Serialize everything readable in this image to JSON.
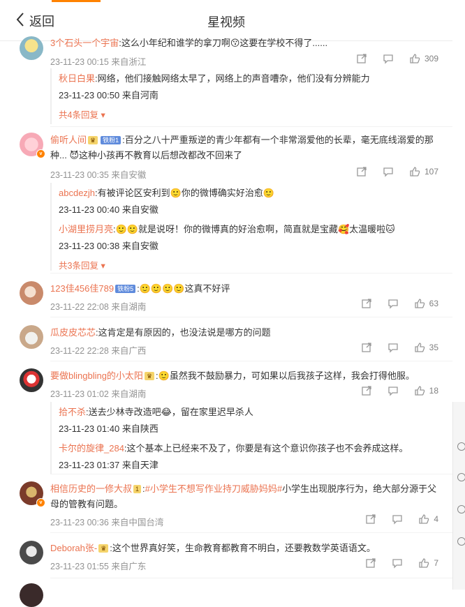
{
  "header": {
    "back_label": "返回",
    "title": "星视频"
  },
  "comments": [
    {
      "name": "3个石头一个宇宙",
      "text": ":这么小年纪和谁学的拿刀啊😗这要在学校不得了......",
      "time": "23-11-23 00:15 来自浙江",
      "likes": "309",
      "replies": [
        {
          "name": "秋日白果",
          "text": ":网络，他们接触网络太早了，网络上的声音嘈杂，他们没有分辨能力",
          "time": "23-11-23 00:50 来自河南"
        }
      ],
      "more": "共4条回复"
    },
    {
      "name": "偷听人间",
      "badge": "铁粉1",
      "text": ":百分之八十严重叛逆的青少年都有一个非常溺爱他的长辈，毫无底线溺爱的那种... 😈这种小孩再不教育以后想改都改不回来了",
      "time": "23-11-23 00:35 来自安徽",
      "likes": "107",
      "replies": [
        {
          "name": "abcdezjh",
          "text": ":有被评论区安利到🙂你的微博确实好治愈🙂",
          "time": "23-11-23 00:40 来自安徽"
        },
        {
          "name": "小湖里捞月亮",
          "text": ":🙂🙂就是说呀！你的微博真的好治愈啊，简直就是宝藏🥰太温暖啦🐱",
          "time": "23-11-23 00:38 来自安徽"
        }
      ],
      "more": "共3条回复"
    },
    {
      "name": "123佳456佳789",
      "badge": "铁粉5",
      "text": ":🙂🙂🙂🙂这真不好评",
      "time": "23-11-22 22:08 来自湖南",
      "likes": "63"
    },
    {
      "name": "瓜皮皮芯芯",
      "text": ":这肯定是有原因的，也没法说是哪方的问题",
      "time": "23-11-22 22:28 来自广西",
      "likes": "35"
    },
    {
      "name": "要做blingbling的小太阳",
      "text": ":🙂虽然我不鼓励暴力，可如果以后我孩子这样，我会打得他服。",
      "time": "23-11-23 01:02 来自湖南",
      "likes": "18",
      "replies": [
        {
          "name": "拾不杀",
          "text": ":送去少林寺改造吧😂，留在家里迟早杀人",
          "time": "23-11-23 01:40 来自陕西"
        },
        {
          "name": "卡尔的旋律_284",
          "text": ":这个基本上已经来不及了，你要是有这个意识你孩子也不会养成这样。",
          "time": "23-11-23 01:37 来自天津"
        }
      ]
    },
    {
      "name": "相信历史的一修大叔",
      "badge": "1",
      "hashtag": "#小学生不想写作业持刀威胁妈妈#",
      "text": "小学生出现脱序行为，绝大部分源于父母的管教有问题。",
      "time": "23-11-23 00:36 来自中国台湾",
      "likes": "4"
    },
    {
      "name": "Deborah张-",
      "text": ":这个世界真好笑，生命教育都教育不明白，还要教数学英语语文。",
      "time": "23-11-23 01:55 来自广东",
      "likes": "7"
    }
  ]
}
